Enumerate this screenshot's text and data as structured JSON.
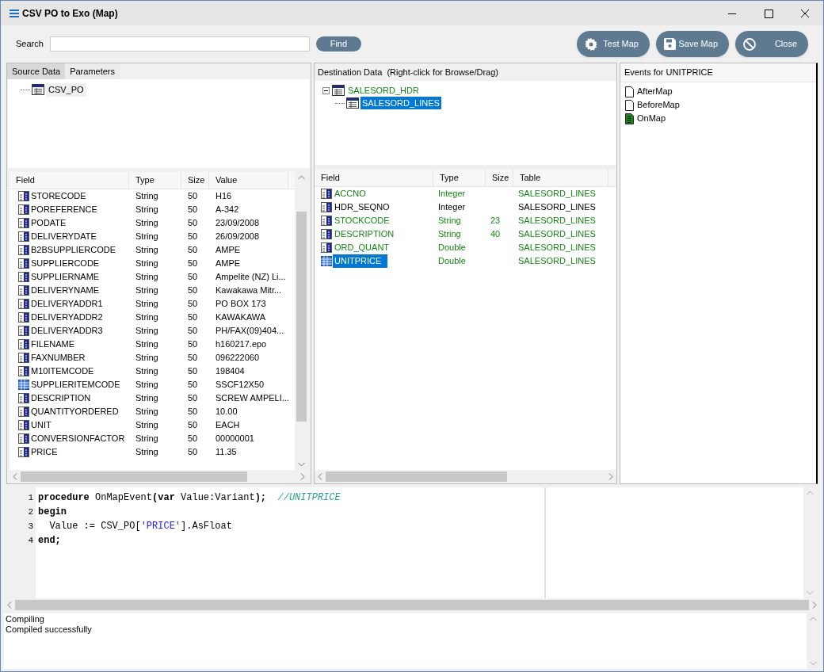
{
  "window": {
    "title": "CSV PO to Exo (Map)"
  },
  "toolbar": {
    "search_label": "Search",
    "find": "Find",
    "buttons": [
      {
        "kind": "test",
        "label": "Test Map"
      },
      {
        "kind": "save",
        "label": "Save Map"
      },
      {
        "kind": "close",
        "label": "Close"
      }
    ]
  },
  "source": {
    "tabs": [
      {
        "label": "Source Data",
        "selected": true
      },
      {
        "label": "Parameters",
        "selected": false
      }
    ],
    "tree": [
      {
        "label": "CSV_PO"
      }
    ],
    "columns": [
      "Field",
      "Type",
      "Size",
      "Value"
    ],
    "rows": [
      {
        "field": "STORECODE",
        "type": "String",
        "size": "50",
        "value": "H16",
        "highlighted": false
      },
      {
        "field": "POREFERENCE",
        "type": "String",
        "size": "50",
        "value": "A-342",
        "highlighted": false
      },
      {
        "field": "PODATE",
        "type": "String",
        "size": "50",
        "value": "23/09/2008",
        "highlighted": false
      },
      {
        "field": "DELIVERYDATE",
        "type": "String",
        "size": "50",
        "value": "26/09/2008",
        "highlighted": false
      },
      {
        "field": "B2BSUPPLIERCODE",
        "type": "String",
        "size": "50",
        "value": "AMPE",
        "highlighted": false
      },
      {
        "field": "SUPPLIERCODE",
        "type": "String",
        "size": "50",
        "value": "AMPE",
        "highlighted": false
      },
      {
        "field": "SUPPLIERNAME",
        "type": "String",
        "size": "50",
        "value": "Ampelite (NZ) Li...",
        "highlighted": false
      },
      {
        "field": "DELIVERYNAME",
        "type": "String",
        "size": "50",
        "value": "Kawakawa Mitr...",
        "highlighted": false
      },
      {
        "field": "DELIVERYADDR1",
        "type": "String",
        "size": "50",
        "value": "PO BOX 173",
        "highlighted": false
      },
      {
        "field": "DELIVERYADDR2",
        "type": "String",
        "size": "50",
        "value": "KAWAKAWA",
        "highlighted": false
      },
      {
        "field": "DELIVERYADDR3",
        "type": "String",
        "size": "50",
        "value": "PH/FAX(09)404...",
        "highlighted": false
      },
      {
        "field": "FILENAME",
        "type": "String",
        "size": "50",
        "value": "h160217.epo",
        "highlighted": false
      },
      {
        "field": "FAXNUMBER",
        "type": "String",
        "size": "50",
        "value": "096222060",
        "highlighted": false
      },
      {
        "field": "M10ITEMCODE",
        "type": "String",
        "size": "50",
        "value": "198404",
        "highlighted": false
      },
      {
        "field": "SUPPLIERITEMCODE",
        "type": "String",
        "size": "50",
        "value": "SSCF12X50",
        "highlighted": true
      },
      {
        "field": "DESCRIPTION",
        "type": "String",
        "size": "50",
        "value": "SCREW AMPELI...",
        "highlighted": false
      },
      {
        "field": "QUANTITYORDERED",
        "type": "String",
        "size": "50",
        "value": "10.00",
        "highlighted": false
      },
      {
        "field": "UNIT",
        "type": "String",
        "size": "50",
        "value": "EACH",
        "highlighted": false
      },
      {
        "field": "CONVERSIONFACTOR",
        "type": "String",
        "size": "50",
        "value": "00000001",
        "highlighted": false
      },
      {
        "field": "PRICE",
        "type": "String",
        "size": "50",
        "value": "11.35",
        "highlighted": false
      }
    ]
  },
  "destination": {
    "title": "Destination Data  (Right-click for Browse/Drag)",
    "tree": [
      {
        "label": "SALESORD_HDR",
        "mapped": true,
        "selected": false,
        "expanded": true,
        "children": [
          {
            "label": "SALESORD_LINES",
            "selected": true
          }
        ]
      }
    ],
    "columns": [
      "Field",
      "Type",
      "Size",
      "Table"
    ],
    "rows": [
      {
        "field": "ACCNO",
        "type": "Integer",
        "table": "SALESORD_LINES",
        "mapped": true,
        "selected": false
      },
      {
        "field": "HDR_SEQNO",
        "type": "Integer",
        "table": "SALESORD_LINES",
        "mapped": false,
        "selected": false
      },
      {
        "field": "STOCKCODE",
        "type": "String",
        "size": "23",
        "table": "SALESORD_LINES",
        "mapped": true,
        "selected": false
      },
      {
        "field": "DESCRIPTION",
        "type": "String",
        "size": "40",
        "table": "SALESORD_LINES",
        "mapped": true,
        "selected": false
      },
      {
        "field": "ORD_QUANT",
        "type": "Double",
        "table": "SALESORD_LINES",
        "mapped": true,
        "selected": false
      },
      {
        "field": "UNITPRICE",
        "type": "Double",
        "table": "SALESORD_LINES",
        "mapped": true,
        "selected": true
      }
    ]
  },
  "events": {
    "title": "Events for UNITPRICE",
    "items": [
      {
        "label": "AfterMap",
        "has_code": false
      },
      {
        "label": "BeforeMap",
        "has_code": false
      },
      {
        "label": "OnMap",
        "has_code": true
      }
    ]
  },
  "editor": {
    "lines": [
      {
        "number": "1",
        "tokens": [
          {
            "kind": "keyword",
            "text": "procedure"
          },
          {
            "kind": "plain",
            "text": " OnMapEvent"
          },
          {
            "kind": "keyword",
            "text": "("
          },
          {
            "kind": "keyword",
            "text": "var"
          },
          {
            "kind": "plain",
            "text": " Value:Variant"
          },
          {
            "kind": "keyword",
            "text": ");  "
          },
          {
            "kind": "comment",
            "text": "//UNITPRICE"
          }
        ]
      },
      {
        "number": "2",
        "tokens": [
          {
            "kind": "keyword",
            "text": "begin"
          }
        ]
      },
      {
        "number": "3",
        "tokens": [
          {
            "kind": "plain",
            "text": "  Value := CSV_PO["
          },
          {
            "kind": "string",
            "text": "'PRICE'"
          },
          {
            "kind": "plain",
            "text": "].AsFloat"
          }
        ]
      },
      {
        "number": "4",
        "tokens": [
          {
            "kind": "keyword",
            "text": "end;"
          }
        ]
      }
    ]
  },
  "output": {
    "lines": [
      "Compiling",
      "Compiled successfully"
    ]
  }
}
